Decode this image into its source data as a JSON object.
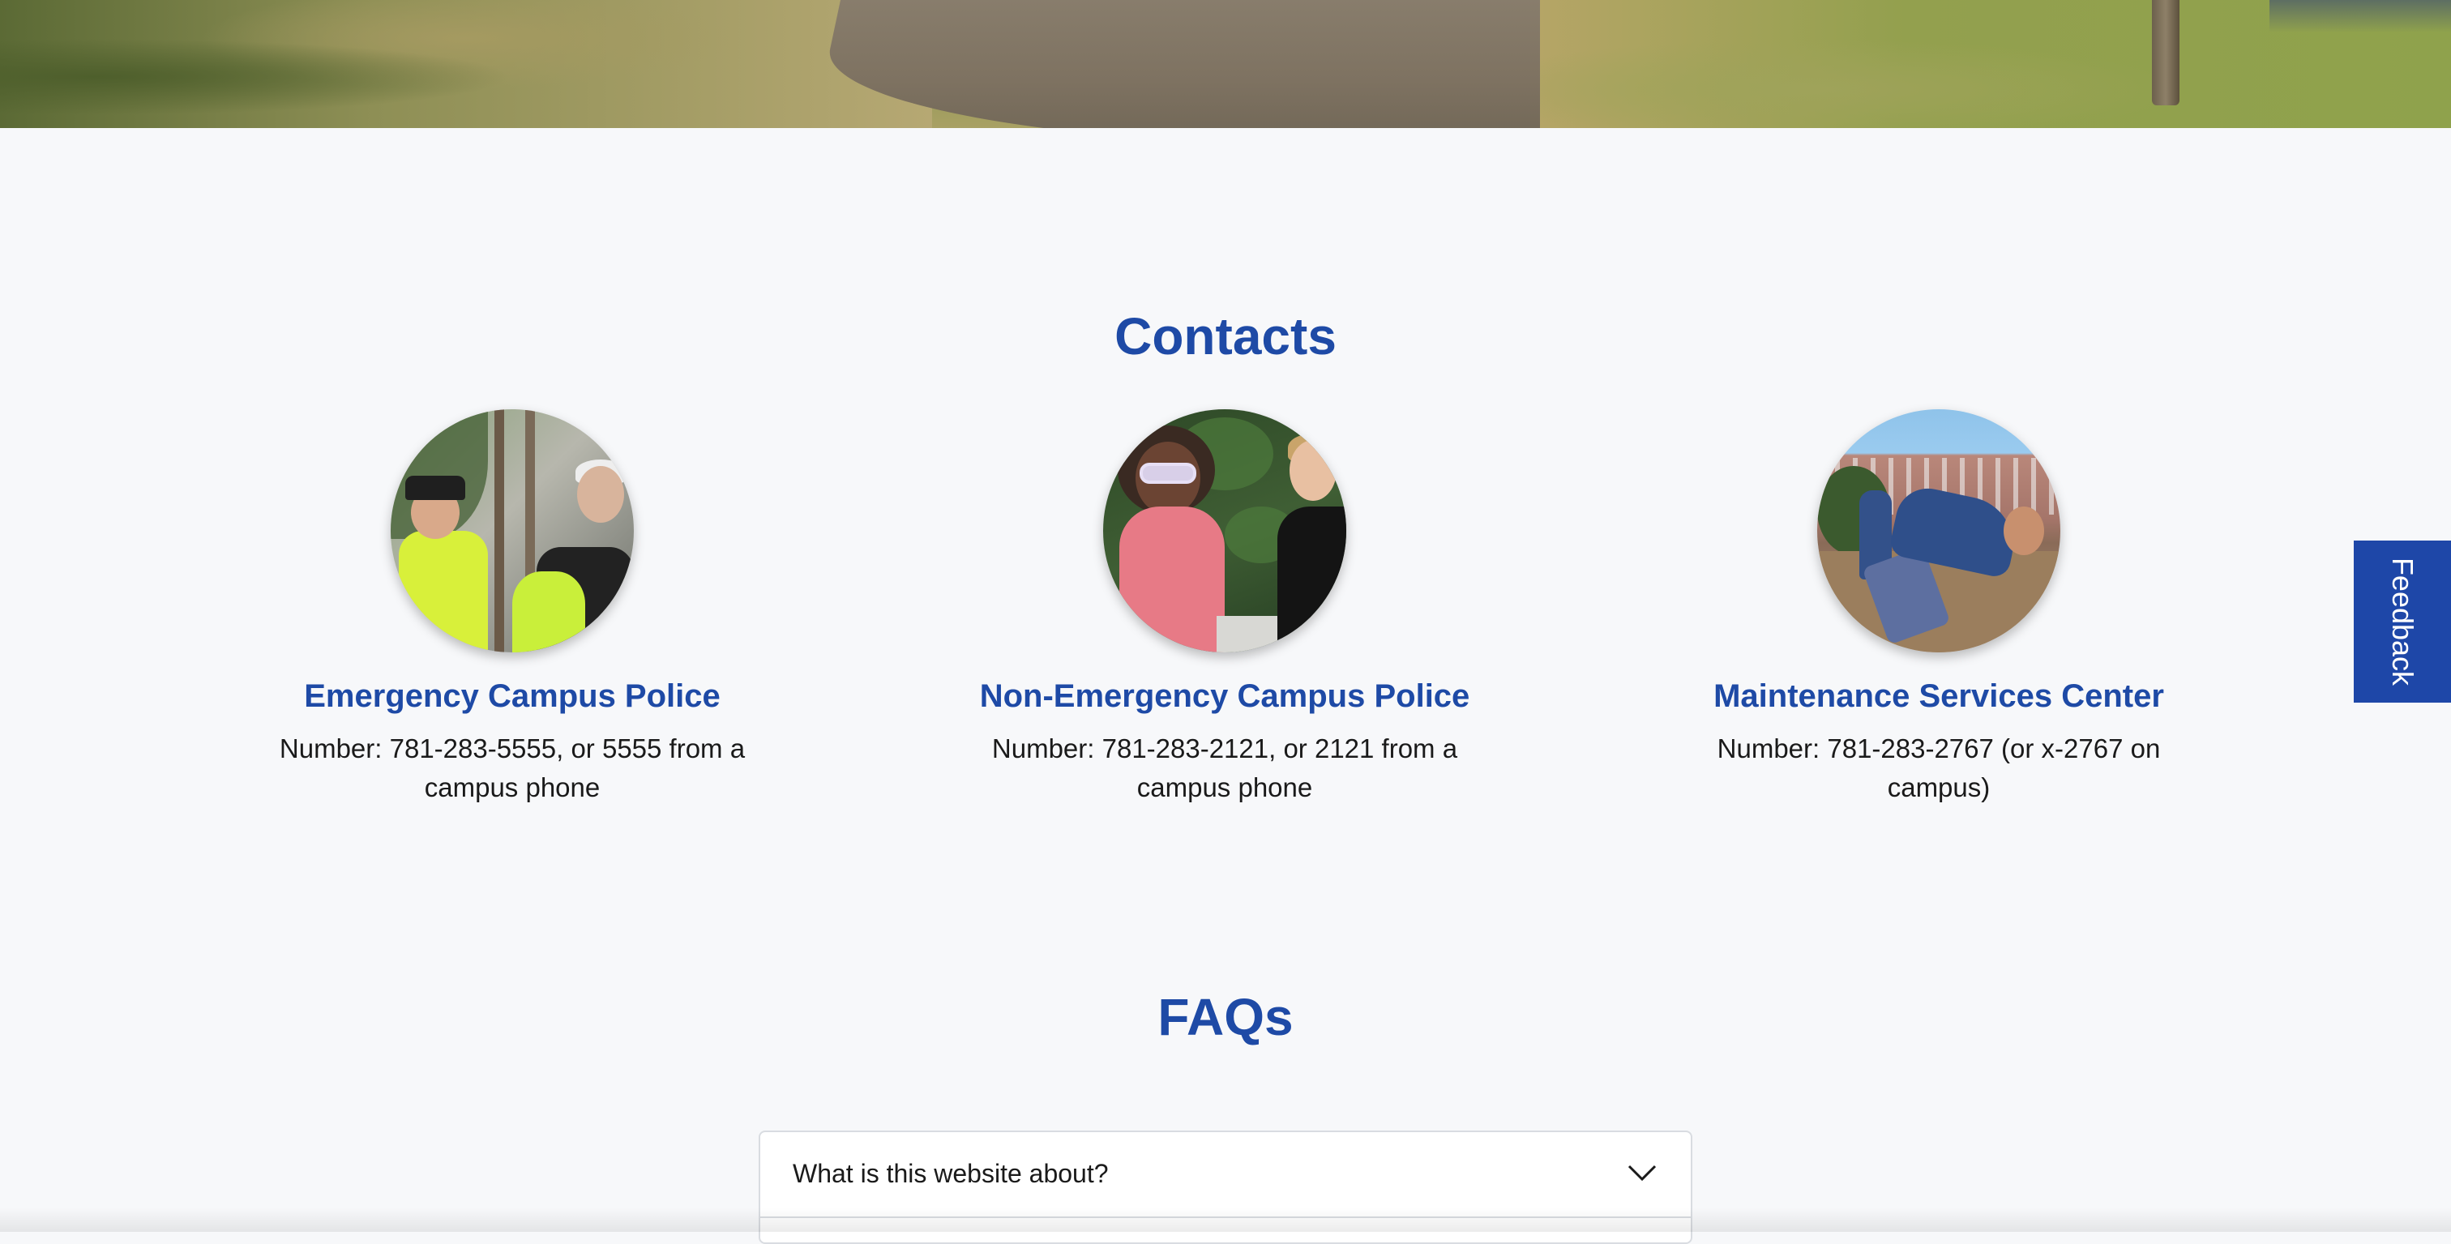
{
  "contacts": {
    "title": "Contacts",
    "items": [
      {
        "name": "Emergency Campus Police",
        "number": "Number: 781-283-5555, or 5555 from a campus phone"
      },
      {
        "name": "Non-Emergency Campus Police",
        "number": "Number: 781-283-2121, or 2121 from a campus phone"
      },
      {
        "name": "Maintenance Services Center",
        "number": "Number: 781-283-2767 (or x-2767 on campus)"
      }
    ]
  },
  "faqs": {
    "title": "FAQs",
    "items": [
      {
        "question": "What is this website about?",
        "expanded": false
      }
    ]
  },
  "feedback": {
    "label": "Feedback"
  },
  "colors": {
    "accent": "#1e4aa6",
    "feedback_bg": "#1e47a8",
    "page_bg": "#f7f8fa"
  },
  "icons": {
    "faq_toggle": "chevron-down-icon"
  }
}
